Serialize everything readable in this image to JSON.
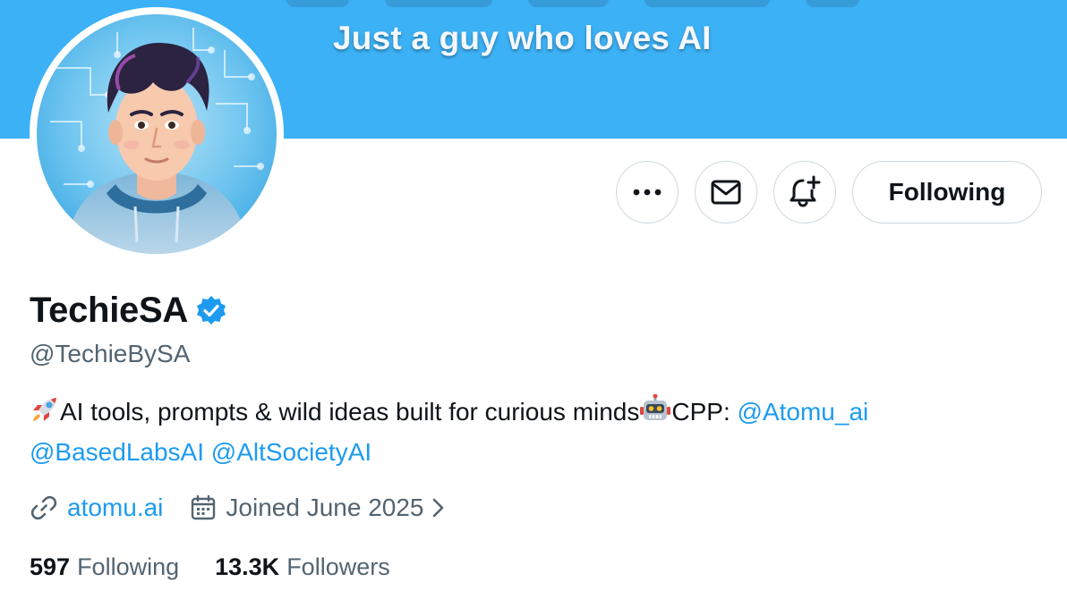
{
  "banner": {
    "text": "Just a guy who loves AI",
    "color": "#3cb1f5"
  },
  "avatar": {
    "icon": "profile-photo"
  },
  "actions": {
    "more_icon": "more-horizontal-icon",
    "message_icon": "envelope-icon",
    "notify_icon": "bell-plus-icon",
    "following_label": "Following"
  },
  "profile": {
    "name": "TechieSA",
    "verified_icon": "verified-badge-icon",
    "handle": "@TechieBySA"
  },
  "bio": {
    "emoji_start": "rocket-emoji",
    "text": "AI tools, prompts & wild ideas built for curious minds",
    "emoji_mid": "robot-emoji",
    "cpp_label": "CPP: ",
    "mentions": [
      "@Atomu_ai",
      "@BasedLabsAI",
      "@AltSocietyAI"
    ]
  },
  "meta": {
    "link_icon": "link-icon",
    "link": "atomu.ai",
    "calendar_icon": "calendar-icon",
    "joined": "Joined June 2025"
  },
  "stats": {
    "following_count": "597",
    "following_label": "Following",
    "followers_count": "13.3K",
    "followers_label": "Followers"
  },
  "colors": {
    "accent": "#1d9bf0",
    "text": "#0f1419",
    "muted": "#536471",
    "border": "#cfd9de"
  }
}
